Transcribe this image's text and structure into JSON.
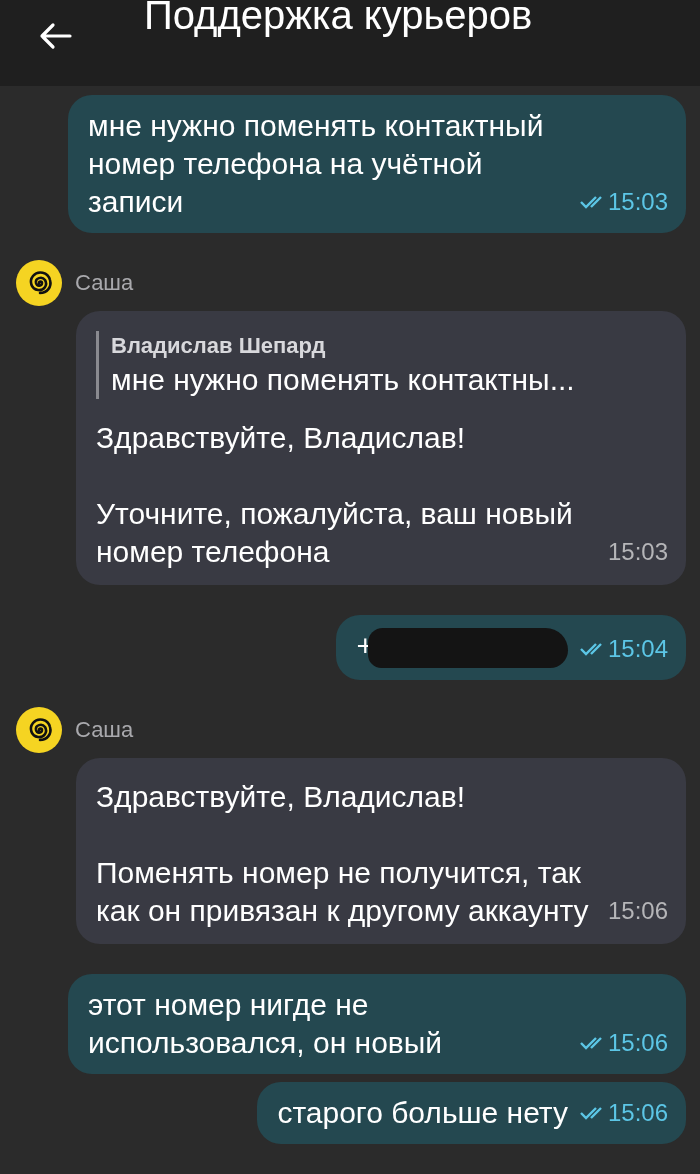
{
  "header": {
    "title": "Поддержка курьеров"
  },
  "messages": [
    {
      "kind": "out",
      "paragraphs": [
        "мне нужно поменять контактный номер телефона на учётной записи"
      ],
      "time": "15:03",
      "read": true
    },
    {
      "kind": "in",
      "sender": "Саша",
      "quote": {
        "author": "Владислав Шепард",
        "text": "мне нужно поменять контактны..."
      },
      "paragraphs": [
        "Здравствуйте, Владислав!",
        "Уточните, пожалуйста, ваш новый номер телефона"
      ],
      "time": "15:03"
    },
    {
      "kind": "out",
      "paragraphs": [
        "+"
      ],
      "redacted": true,
      "time": "15:04",
      "read": true
    },
    {
      "kind": "in",
      "sender": "Саша",
      "paragraphs": [
        "Здравствуйте, Владислав!",
        "Поменять номер не получится, так как он привязан к другому аккаунту"
      ],
      "time": "15:06"
    },
    {
      "kind": "out",
      "paragraphs": [
        "этот номер нигде не использовался, он новый"
      ],
      "time": "15:06",
      "read": true
    },
    {
      "kind": "out",
      "paragraphs": [
        "старого больше нету"
      ],
      "time": "15:06",
      "read": true
    }
  ]
}
